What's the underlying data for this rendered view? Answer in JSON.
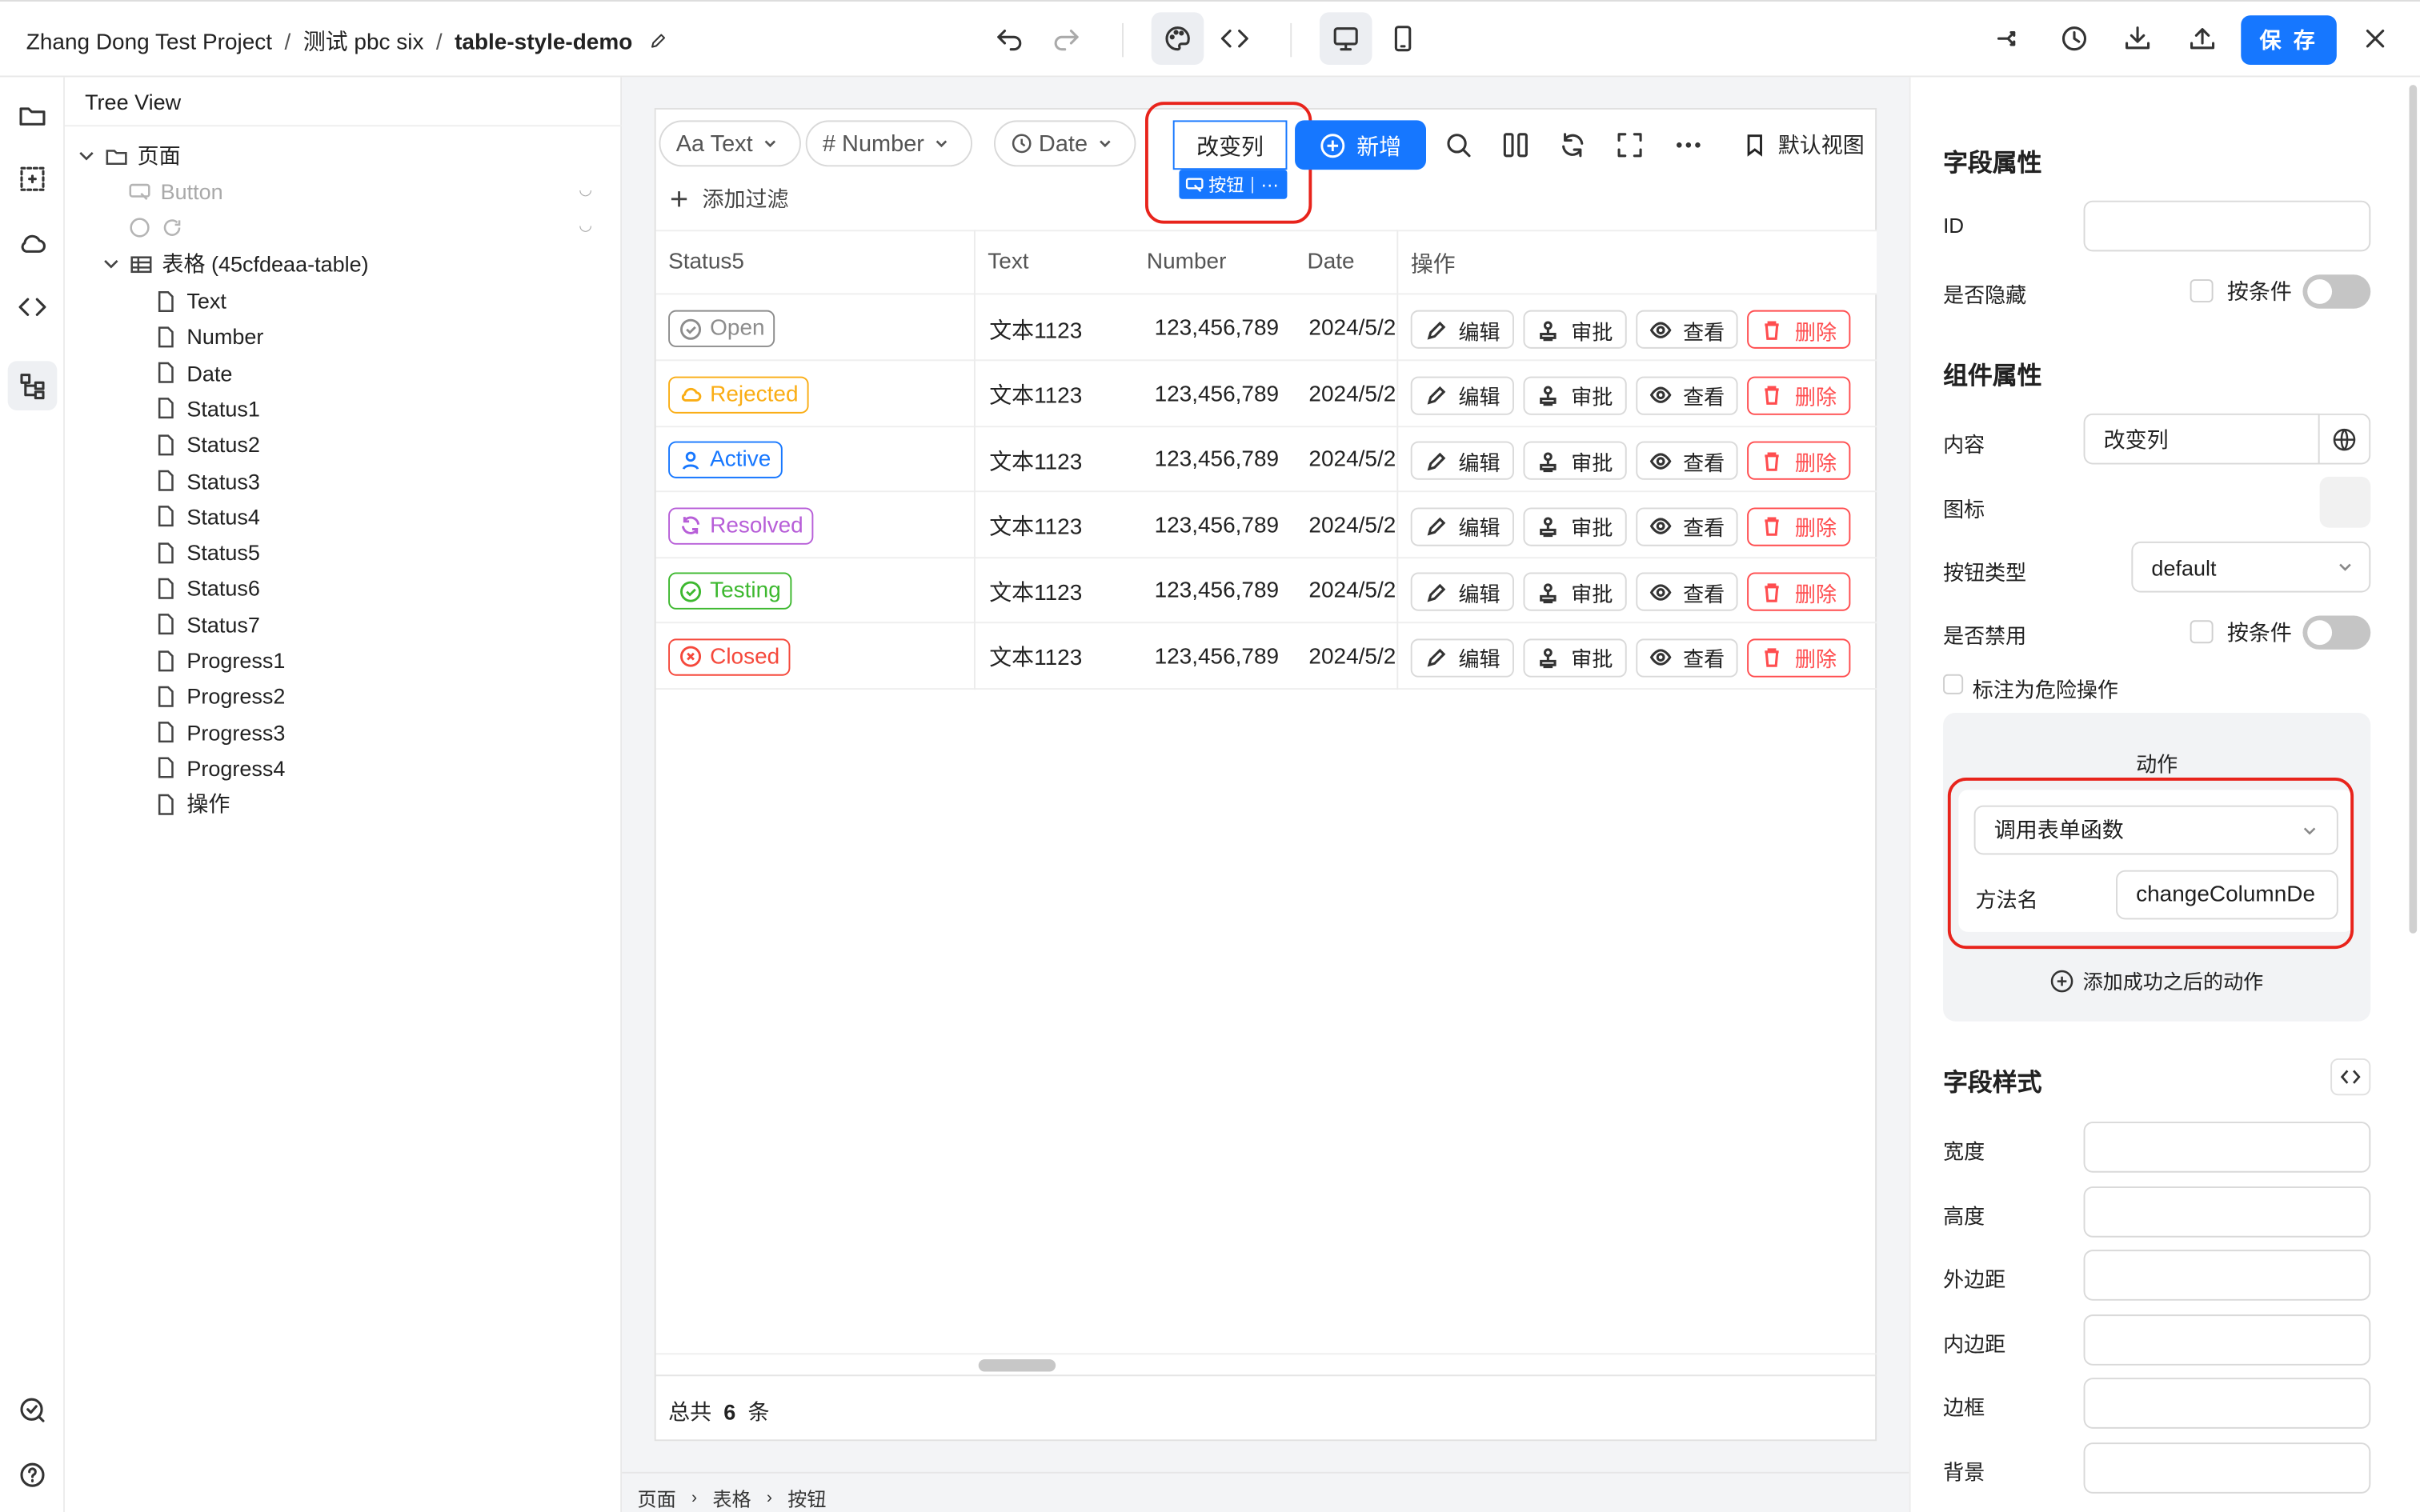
{
  "breadcrumb": {
    "project": "Zhang Dong Test Project",
    "folder": "测试 pbc six",
    "page": "table-style-demo"
  },
  "topbar": {
    "save_label": "保 存"
  },
  "tree": {
    "title": "Tree View",
    "page_node": "页面",
    "button_node": "Button",
    "table_node": "表格 (45cfdeaa-table)",
    "columns": [
      "Text",
      "Number",
      "Date",
      "Status1",
      "Status2",
      "Status3",
      "Status4",
      "Status5",
      "Status6",
      "Status7",
      "Progress1",
      "Progress2",
      "Progress3",
      "Progress4",
      "操作"
    ]
  },
  "table": {
    "filters": {
      "text": "Aa Text",
      "number": "# Number",
      "date": "Date",
      "add_filter": "添加过滤"
    },
    "change_column_button": "改变列",
    "selection_badge": "按钮",
    "add_button": "新增",
    "default_view": "默认视图",
    "headers": [
      "Status5",
      "Text",
      "Number",
      "Date",
      "操作"
    ],
    "rows": [
      {
        "status": "Open",
        "status_color": "#8c8c8c",
        "text": "文本1123",
        "number": "123,456,789",
        "date": "2024/5/2"
      },
      {
        "status": "Rejected",
        "status_color": "#faad14",
        "text": "文本1123",
        "number": "123,456,789",
        "date": "2024/5/2"
      },
      {
        "status": "Active",
        "status_color": "#1677ff",
        "text": "文本1123",
        "number": "123,456,789",
        "date": "2024/5/2"
      },
      {
        "status": "Resolved",
        "status_color": "#b75ed8",
        "text": "文本1123",
        "number": "123,456,789",
        "date": "2024/5/2"
      },
      {
        "status": "Testing",
        "status_color": "#3db82f",
        "text": "文本1123",
        "number": "123,456,789",
        "date": "2024/5/2"
      },
      {
        "status": "Closed",
        "status_color": "#f5483b",
        "text": "文本1123",
        "number": "123,456,789",
        "date": "2024/5/2"
      }
    ],
    "actions": {
      "edit": "编辑",
      "approve": "审批",
      "view": "查看",
      "delete": "删除"
    },
    "footer": {
      "prefix": "总共",
      "count": "6",
      "suffix": "条"
    }
  },
  "status_bar": {
    "crumbs": [
      "页面",
      "表格",
      "按钮"
    ]
  },
  "props": {
    "field_props_title": "字段属性",
    "id_label": "ID",
    "id_value": "",
    "hidden_label": "是否隐藏",
    "conditional_label": "按条件",
    "component_props_title": "组件属性",
    "content_label": "内容",
    "content_value": "改变列",
    "icon_label": "图标",
    "button_type_label": "按钮类型",
    "button_type_value": "default",
    "disabled_label": "是否禁用",
    "danger_label": "标注为危险操作",
    "action_title": "动作",
    "action_select_value": "调用表单函数",
    "method_label": "方法名",
    "method_value": "changeColumnDe",
    "add_success_action": "添加成功之后的动作",
    "field_style_title": "字段样式",
    "style_fields": [
      "宽度",
      "高度",
      "外边距",
      "内边距",
      "边框",
      "背景"
    ]
  },
  "colors": {
    "primary": "#1677ff",
    "danger": "#ff4d4f",
    "highlight": "#e8231b"
  }
}
